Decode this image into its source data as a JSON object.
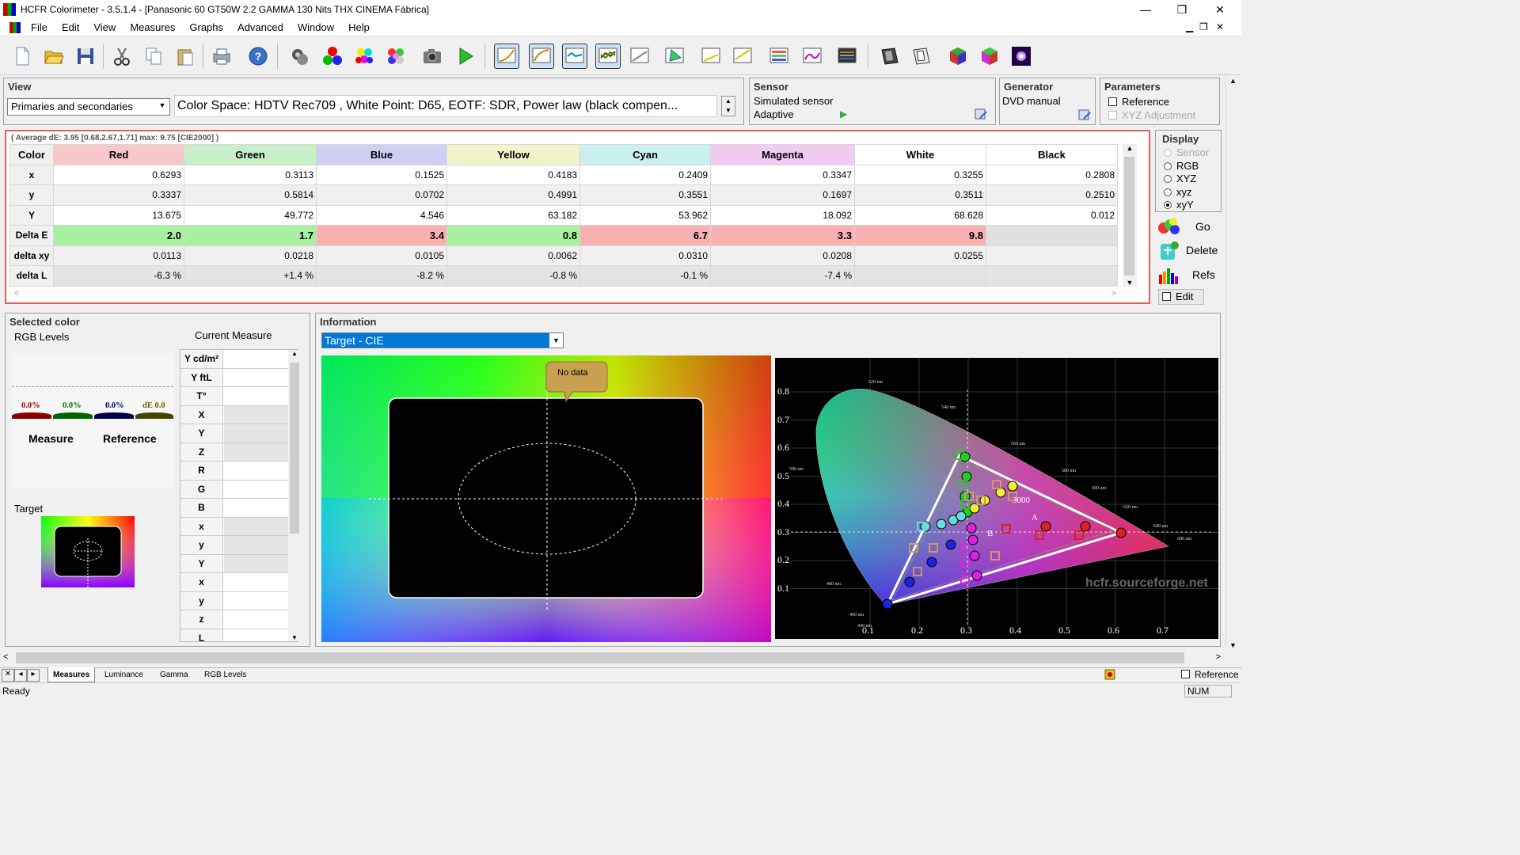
{
  "window": {
    "title": "HCFR Colorimeter - 3.5.1.4 - [Panasonic 60 GT50W 2.2 GAMMA 130 Nits THX CINEMA Fábrica]",
    "minimize": "—",
    "restore": "❐",
    "close": "✕"
  },
  "menu": [
    "File",
    "Edit",
    "View",
    "Measures",
    "Graphs",
    "Advanced",
    "Window",
    "Help"
  ],
  "view": {
    "label": "View",
    "mode": "Primaries and secondaries",
    "info": "Color Space: HDTV Rec709 , White Point: D65, EOTF:  SDR, Power law (black compen..."
  },
  "sensor": {
    "label": "Sensor",
    "name": "Simulated sensor",
    "mode": "Adaptive"
  },
  "generator": {
    "label": "Generator",
    "name": "DVD manual"
  },
  "parameters": {
    "label": "Parameters",
    "reference": "Reference",
    "xyz_adjustment": "XYZ Adjustment"
  },
  "measures": {
    "average": "( Average dE: 3.95 [0.68,2.67,1.71] max: 9.75 [CIE2000] )",
    "columns": [
      {
        "name": "Color",
        "bg": "#f0f0f0"
      },
      {
        "name": "Red",
        "bg": "#f7c8c8"
      },
      {
        "name": "Green",
        "bg": "#c8f0c8"
      },
      {
        "name": "Blue",
        "bg": "#cfcff3"
      },
      {
        "name": "Yellow",
        "bg": "#f3f3cc"
      },
      {
        "name": "Cyan",
        "bg": "#c9f0ee"
      },
      {
        "name": "Magenta",
        "bg": "#f1cbf1"
      },
      {
        "name": "White",
        "bg": "#ffffff"
      },
      {
        "name": "Black",
        "bg": "#ffffff"
      }
    ],
    "rows": [
      {
        "label": "x",
        "values": [
          "0.6293",
          "0.3113",
          "0.1525",
          "0.4183",
          "0.2409",
          "0.3347",
          "0.3255",
          "0.2808"
        ]
      },
      {
        "label": "y",
        "values": [
          "0.3337",
          "0.5814",
          "0.0702",
          "0.4991",
          "0.3551",
          "0.1697",
          "0.3511",
          "0.2510"
        ]
      },
      {
        "label": "Y",
        "values": [
          "13.675",
          "49.772",
          "4.546",
          "63.182",
          "53.962",
          "18.092",
          "68.628",
          "0.012"
        ]
      },
      {
        "label": "Delta E",
        "values": [
          "2.0",
          "1.7",
          "3.4",
          "0.8",
          "6.7",
          "3.3",
          "9.8",
          ""
        ]
      },
      {
        "label": "delta xy",
        "values": [
          "0.0113",
          "0.0218",
          "0.0105",
          "0.0062",
          "0.0310",
          "0.0208",
          "0.0255",
          ""
        ]
      },
      {
        "label": "delta L",
        "values": [
          "-6.3 %",
          "+1.4 %",
          "-8.2 %",
          "-0.8 %",
          "-0.1 %",
          "-7.4 %",
          "",
          ""
        ]
      }
    ],
    "delta_e_colors": [
      "#a8f0a0",
      "#a8f0a0",
      "#f8b0b0",
      "#a8f0a0",
      "#f8b0b0",
      "#f8b0b0",
      "#f8b0b0",
      "#e0e0e0"
    ]
  },
  "display": {
    "label": "Display",
    "options": [
      "Sensor",
      "RGB",
      "XYZ",
      "xyz",
      "xyY"
    ],
    "selected": "xyY",
    "go": "Go",
    "delete": "Delete",
    "refs": "Refs",
    "edit": "Edit"
  },
  "selected_color": {
    "label": "Selected color",
    "rgb_levels": "RGB Levels",
    "current_measure": "Current Measure",
    "levels": [
      "0.0%",
      "0.0%",
      "0.0%",
      "dE 0.0"
    ],
    "measure": "Measure",
    "reference": "Reference",
    "target": "Target",
    "rows": [
      "Y cd/m²",
      "Y ftL",
      "T°",
      "X",
      "Y",
      "Z",
      "R",
      "G",
      "B",
      "x",
      "y",
      "Y",
      "x",
      "y",
      "z",
      "L"
    ]
  },
  "information": {
    "label": "Information",
    "mode": "Target - CIE",
    "no_data": "No data",
    "watermark": "hcfr.sourceforge.net",
    "cie_x_ticks": [
      "0.1",
      "0.2",
      "0.3",
      "0.4",
      "0.5",
      "0.6",
      "0.7"
    ],
    "cie_y_ticks": [
      "0.8",
      "0.7",
      "0.6",
      "0.5",
      "0.4",
      "0.3",
      "0.2",
      "0.1"
    ],
    "wavelengths": [
      "520 nm",
      "540 nm",
      "560 nm",
      "580 nm",
      "600 nm",
      "620 nm",
      "640 nm",
      "680 nm",
      "500 nm",
      "480 nm",
      "460 nm",
      "440 nm"
    ],
    "labels": [
      "A",
      "B",
      "3000"
    ]
  },
  "tabs": [
    "Measures",
    "Luminance",
    "Gamma",
    "RGB Levels"
  ],
  "statusbar": {
    "ready": "Ready",
    "reference": "Reference",
    "num": "NUM"
  }
}
